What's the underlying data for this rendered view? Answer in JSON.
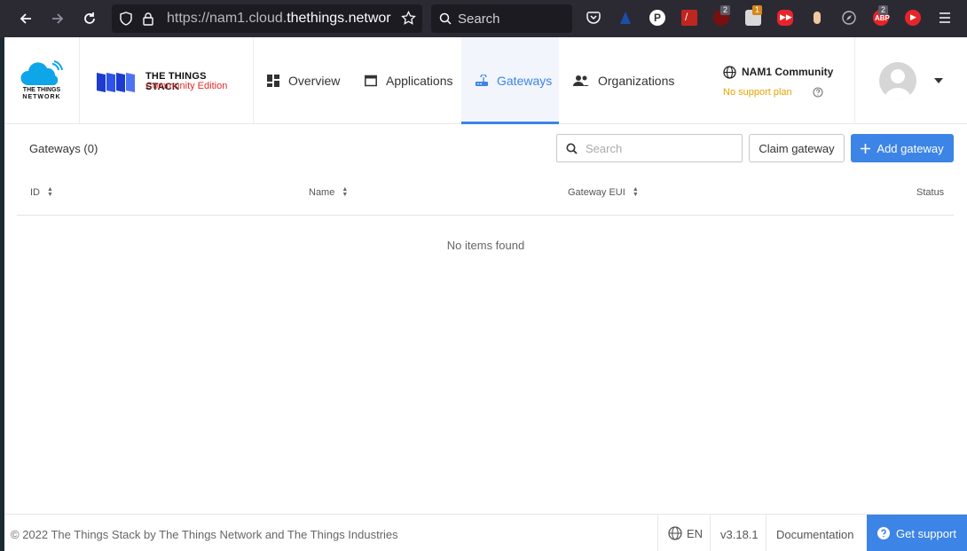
{
  "browser": {
    "url_prefix": "https://nam1.cloud.",
    "url_domain": "thethings.networ",
    "search_label": "Search",
    "badge_ublock": "2",
    "badge_ext": "1",
    "badge_abp": "2"
  },
  "header": {
    "logo_ttn_line1": "THE THINGS",
    "logo_ttn_line2": "NETWORK",
    "stack_title": "THE THINGS STACK",
    "stack_subtitle": "Community Edition",
    "nav": {
      "overview": "Overview",
      "applications": "Applications",
      "gateways": "Gateways",
      "organizations": "Organizations"
    },
    "community_name": "NAM1 Community",
    "support_plan": "No support plan"
  },
  "main": {
    "title": "Gateways (0)",
    "search_placeholder": "Search",
    "claim_label": "Claim gateway",
    "add_label": "Add gateway",
    "columns": {
      "id": "ID",
      "name": "Name",
      "eui": "Gateway EUI",
      "status": "Status"
    },
    "empty_message": "No items found"
  },
  "footer": {
    "copyright": "© 2022 The Things Stack by The Things Network and The Things Industries",
    "language": "EN",
    "version": "v3.18.1",
    "documentation": "Documentation",
    "support": "Get support"
  },
  "colors": {
    "accent": "#3c84e6",
    "warning": "#e8a200",
    "brand_red": "#e02a2a"
  }
}
